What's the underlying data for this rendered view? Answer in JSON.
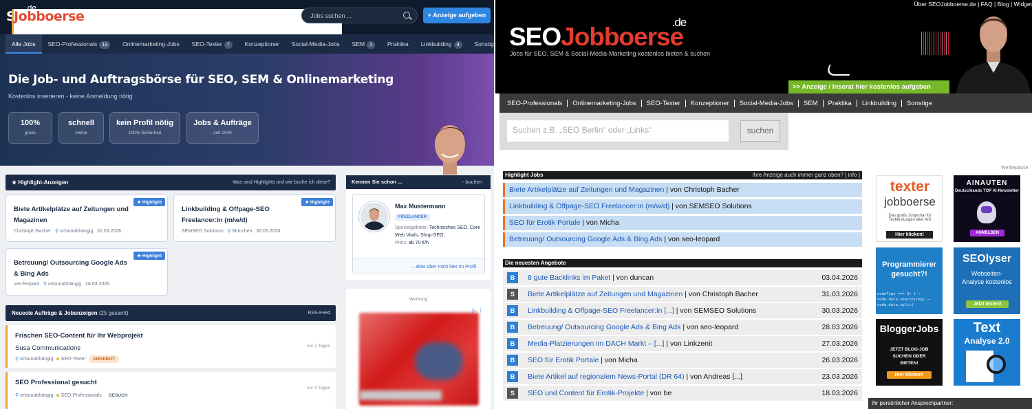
{
  "left": {
    "logo": {
      "seo": "SEO",
      "job": "Jobboerse",
      "de": ".de"
    },
    "search_placeholder": "Jobs suchen ...",
    "add_button": "+ Anzeige aufgeben",
    "nav": [
      {
        "label": "Alle Jobs",
        "count": ""
      },
      {
        "label": "SEO-Professionals",
        "count": "13"
      },
      {
        "label": "Onlinemarketing-Jobs",
        "count": ""
      },
      {
        "label": "SEO-Texter",
        "count": "7"
      },
      {
        "label": "Konzeptioner",
        "count": ""
      },
      {
        "label": "Social-Media-Jobs",
        "count": ""
      },
      {
        "label": "SEM",
        "count": "1"
      },
      {
        "label": "Praktika",
        "count": ""
      },
      {
        "label": "Linkbuilding",
        "count": "4"
      },
      {
        "label": "Sonstiges",
        "count": ""
      }
    ],
    "hero": {
      "title": "Die Job- und Auftragsbörse für SEO, SEM & Onlinemarketing",
      "subtitle": "Kostenlos inserieren - keine Anmeldung nötig",
      "stats": [
        {
          "value": "100%",
          "label": "gratis"
        },
        {
          "value": "schnell",
          "label": "online"
        },
        {
          "value": "kein Profil nötig",
          "label": "100% Sicherheit"
        },
        {
          "value": "Jobs & Aufträge",
          "label": "seit 2009"
        }
      ]
    },
    "highlights": {
      "header": "★ Highlight-Anzeigen",
      "header_link": "Was sind Highlights und wie buche ich diese?",
      "badge": "★ Highlight",
      "items": [
        {
          "title": "Biete Artikelplätze auf Zeitungen und Magazinen",
          "author": "Christoph Bacher",
          "location": "ortsunabhängig",
          "date": "31.03.2026"
        },
        {
          "title": "Linkbuilding & Offpage-SEO Freelancer:in (m/w/d)",
          "author": "SEMSEO Solutions",
          "location": "München",
          "date": "30.03.2026"
        },
        {
          "title": "Betreuung/ Outsourcing Google Ads & Bing Ads",
          "author": "seo-leopard",
          "location": "ortsunabhängig",
          "date": "28.03.2026"
        }
      ]
    },
    "newest": {
      "header": "Neueste Aufträge & Jobanzeigen",
      "count": "(25 gesamt)",
      "rss": "RSS-Feed",
      "items": [
        {
          "title": "Frischen SEO-Content für Ihr Webprojekt",
          "company": "Susa Communications",
          "location": "ortsunabhängig",
          "category": "SEO-Texter",
          "type": "ANGEBOT",
          "ago": "vor 2 Tagen"
        },
        {
          "title": "SEO Professional gesucht",
          "company": "",
          "location": "ortsunabhängig",
          "category": "SEO-Professionals",
          "type": "GESUCH",
          "ago": "vor 3 Tagen"
        }
      ]
    },
    "profile": {
      "header": "Kennen Sie schon ...",
      "header_link": "- buchen",
      "name": "Max Mustermann",
      "badge": "FREELANCER",
      "spec_label": "Spezialgebiete:",
      "spec_value": "Technisches SEO, Core Web Vitals, Shop-SEO,",
      "price_label": "Preis:",
      "price_value": "ab 70 €/h",
      "link": "→ alles über mich hier im Profil"
    },
    "ad_label": "Werbung"
  },
  "right": {
    "toplinks": "Über SEOJobboerse.de | FAQ | Blog | Widget",
    "logo": {
      "seo": "SEO",
      "job": "Jobboerse",
      "de": ".de"
    },
    "tagline": "Jobs für SEO, SEM & Social-Media-Marketing kostenlos bieten & suchen",
    "green_bar": ">> Anzeige / Inserat hier kostenlos aufgeben",
    "nav": [
      "SEO-Professionals",
      "Onlinemarketing-Jobs",
      "SEO-Texter",
      "Konzeptioner",
      "Social-Media-Jobs",
      "SEM",
      "Praktika",
      "Linkbuilding",
      "Sonstige"
    ],
    "search_placeholder": "Suchen z.B. „SEO Berlin“ oder „Links“",
    "search_button": "suchen",
    "highlight": {
      "header": "Highlight Jobs",
      "header_link": "Ihre Anzeige auch immer ganz oben? [ info ]",
      "items": [
        {
          "title": "Biete Artikelplätze auf Zeitungen und Magazinen",
          "by": " | von Christoph Bacher"
        },
        {
          "title": "Linkbuilding & Offpage-SEO Freelancer:in (m/w/d)",
          "by": " | von SEMSEO Solutions"
        },
        {
          "title": "SEO für Erotik Portale",
          "by": " | von Micha"
        },
        {
          "title": "Betreuung/ Outsourcing Google Ads & Bing Ads",
          "by": " | von seo-leopard"
        }
      ]
    },
    "newest": {
      "header": "Die neuesten Angebote",
      "items": [
        {
          "icon": "B",
          "title": "8 gute Backlinks im Paket",
          "by": " | von duncan",
          "date": "03.04.2026"
        },
        {
          "icon": "S",
          "title": "Biete Artikelplätze auf Zeitungen und Magazinen",
          "by": " | von Christoph Bacher",
          "date": "31.03.2026"
        },
        {
          "icon": "B",
          "title": "Linkbuilding & Offpage-SEO Freelancer:in [...]",
          "by": " | von SEMSEO Solutions",
          "date": "30.03.2026"
        },
        {
          "icon": "B",
          "title": "Betreuung/ Outsourcing Google Ads & Bing Ads",
          "by": " | von seo-leopard",
          "date": "28.03.2026"
        },
        {
          "icon": "B",
          "title": "Media-Platzierungen im DACH Markt – [...]",
          "by": " | von Linkzenit",
          "date": "27.03.2026"
        },
        {
          "icon": "B",
          "title": "SEO für Erotik Portale",
          "by": " | von Micha",
          "date": "26.03.2026"
        },
        {
          "icon": "B",
          "title": "Biete Artikel auf regionalem News-Portal (DR 64)",
          "by": " | von Andreas [...]",
          "date": "23.03.2026"
        },
        {
          "icon": "S",
          "title": "SEO und Content für Erotik-Projekte",
          "by": " | von be",
          "date": "18.03.2026"
        }
      ]
    },
    "werbepause": "Werbepause",
    "ads": [
      {
        "line1": "texter",
        "line2": "jobboerse",
        "line3": "Das gratis Jobportal für Textleistungen aller Art!",
        "cta": "Hier klicken!"
      },
      {
        "line1": "AINAUTEN",
        "line2": "Deutschlands TOP AI-Newsletter",
        "cta": "ANMELDEN"
      },
      {
        "line1": "Programmierer gesucht?!",
        "code": "nodeType === 3) { → node.data.search(reg) → node.data.split(",
        "cta": ""
      },
      {
        "line1": "SEOlyser",
        "line2": "Webseiten-Analyse kostenlos",
        "cta": "Jetzt testen!"
      },
      {
        "line1": "BloggerJobs",
        "line2": "JETZT BLOG-JOB SUCHEN ODER BIETEN!",
        "cta": "Hier klicken!"
      },
      {
        "line1": "Text",
        "line2": "Analyse 2.0",
        "cta": ""
      }
    ],
    "contact": "Ihr persönlicher Ansprechpartner:"
  }
}
